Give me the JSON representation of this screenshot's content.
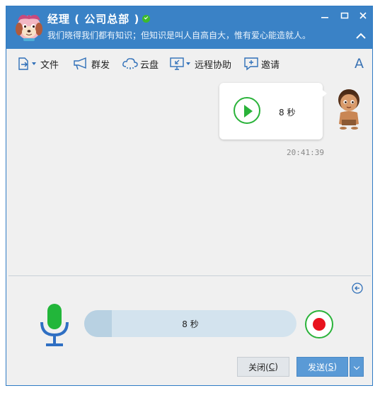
{
  "window": {
    "title": "经理 ( 公司总部 )",
    "subtitle": "我们晓得我们都有知识；但知识是叫人自高自大，惟有爱心能造就人。",
    "status": "online"
  },
  "toolbar": {
    "file_label": "文件",
    "broadcast_label": "群发",
    "cloud_label": "云盘",
    "remote_label": "远程协助",
    "invite_label": "邀请",
    "font_label": "A"
  },
  "messages": [
    {
      "type": "voice",
      "duration_label": "8 秒",
      "timestamp": "20:41:39"
    }
  ],
  "recorder": {
    "duration_label": "8 秒",
    "progress": 0.13
  },
  "footer": {
    "close_label": "关闭(",
    "close_key": "C",
    "close_suffix": ")",
    "send_label": "发送(",
    "send_key": "S",
    "send_suffix": ")"
  },
  "colors": {
    "titlebar": "#3a82c6",
    "accent_green": "#2ab33a",
    "record_red": "#e8121e",
    "mic_green": "#22b63a",
    "mic_blue": "#2f6fc3"
  }
}
